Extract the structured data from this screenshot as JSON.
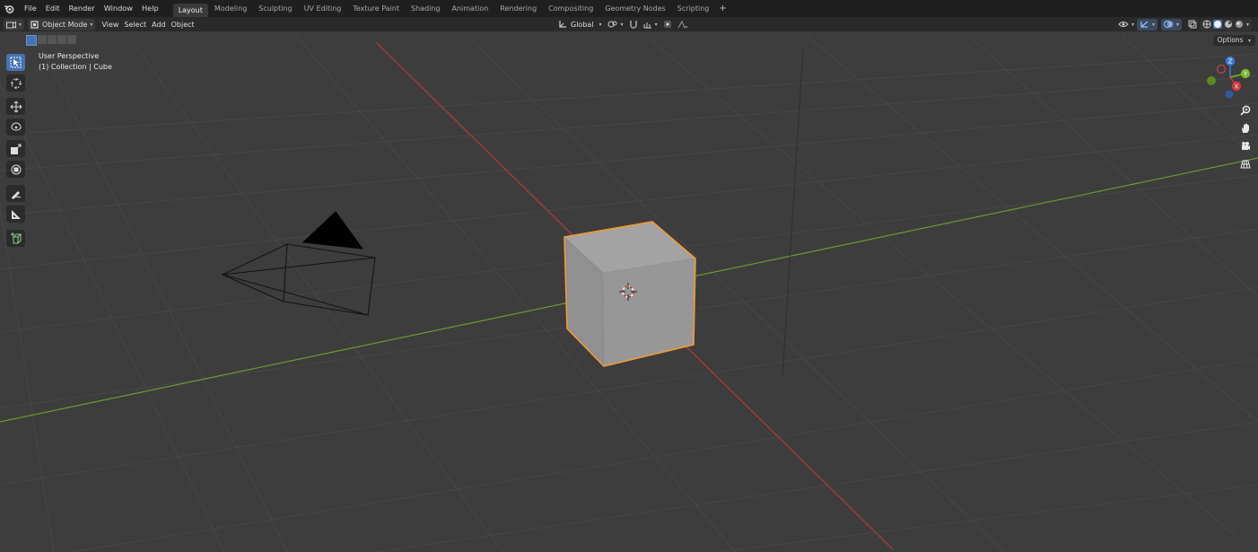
{
  "menubar": {
    "items": [
      "File",
      "Edit",
      "Render",
      "Window",
      "Help"
    ],
    "tabs": [
      "Layout",
      "Modeling",
      "Sculpting",
      "UV Editing",
      "Texture Paint",
      "Shading",
      "Animation",
      "Rendering",
      "Compositing",
      "Geometry Nodes",
      "Scripting"
    ],
    "active_tab": "Layout",
    "add_tab": "+"
  },
  "header": {
    "mode": "Object Mode",
    "menus": [
      "View",
      "Select",
      "Add",
      "Object"
    ],
    "orientation": "Global",
    "options_label": "Options"
  },
  "viewport": {
    "view_name": "User Perspective",
    "collection_info": "(1) Collection | Cube",
    "gizmo_axes": [
      "Z",
      "Y",
      "X"
    ]
  },
  "colors": {
    "accent": "#4772b3",
    "selection_outline": "#f29a32",
    "x_axis": "#b83a3a",
    "y_axis": "#6c9a2e",
    "grid": "#4a4a4a",
    "background": "#3d3d3d"
  }
}
